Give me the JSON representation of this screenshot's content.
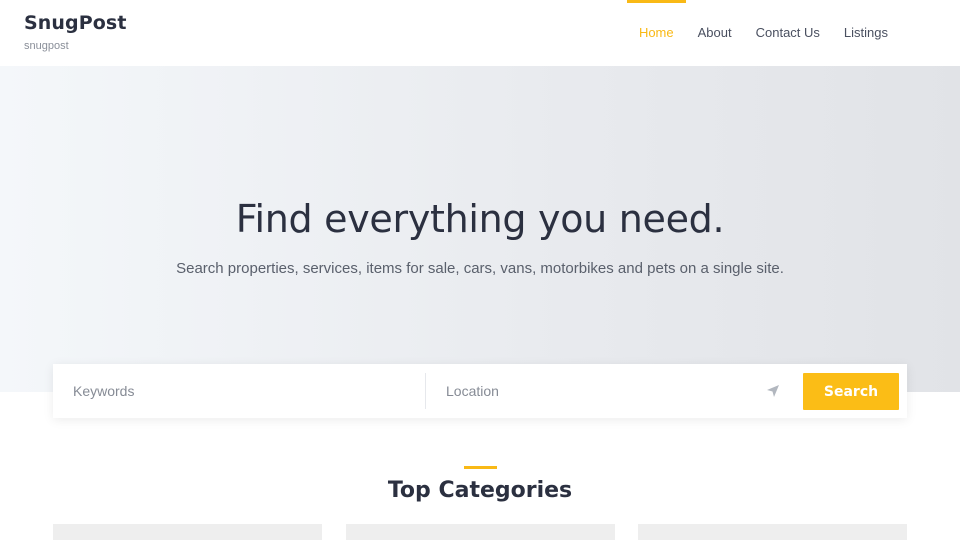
{
  "brand": {
    "name": "SnugPost",
    "tagline": "snugpost"
  },
  "nav": {
    "items": [
      {
        "label": "Home",
        "active": true
      },
      {
        "label": "About",
        "active": false
      },
      {
        "label": "Contact Us",
        "active": false
      },
      {
        "label": "Listings",
        "active": false
      }
    ]
  },
  "hero": {
    "title": "Find everything you need.",
    "subtitle": "Search properties, services, items for sale, cars, vans, motorbikes and pets on a single site."
  },
  "search": {
    "keywords_placeholder": "Keywords",
    "keywords_value": "",
    "location_placeholder": "Location",
    "location_value": "",
    "location_icon": "location-arrow-icon",
    "button_label": "Search"
  },
  "categories": {
    "title": "Top Categories",
    "cards_visible": 3
  },
  "colors": {
    "accent": "#fbbd16",
    "text_dark": "#2b3040",
    "hero_bg": "#e8eaee"
  }
}
